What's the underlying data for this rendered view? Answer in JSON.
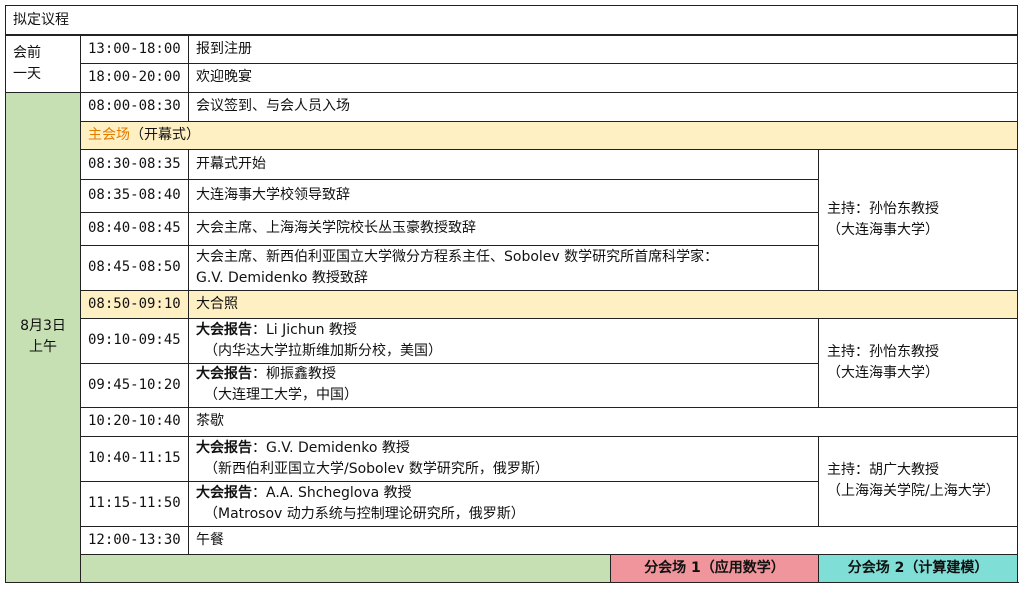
{
  "title": "拟定议程",
  "pre_day": {
    "label_line1": "会前",
    "label_line2": "一天",
    "rows": [
      {
        "time": "13:00-18:00",
        "event": "报到注册"
      },
      {
        "time": "18:00-20:00",
        "event": "欢迎晚宴"
      }
    ]
  },
  "day1": {
    "label_line1": "8月3日",
    "label_line2": "上午",
    "checkin": {
      "time": "08:00-08:30",
      "event": "会议签到、与会人员入场"
    },
    "venue": {
      "name": "主会场",
      "note": "（开幕式）"
    },
    "opening": [
      {
        "time": "08:30-08:35",
        "event": "开幕式开始"
      },
      {
        "time": "08:35-08:40",
        "event": "大连海事大学校领导致辞"
      },
      {
        "time": "08:40-08:45",
        "event": "大会主席、上海海关学院校长丛玉豪教授致辞"
      },
      {
        "time": "08:45-08:50",
        "event": "大会主席、新西伯利亚国立大学微分方程系主任、Sobolev 数学研究所首席科学家：",
        "event2": "G.V. Demidenko 教授致辞"
      }
    ],
    "host1": {
      "line1": "主持：孙怡东教授",
      "line2": "（大连海事大学）"
    },
    "photo": {
      "time": "08:50-09:10",
      "event": "大合照"
    },
    "talks1": [
      {
        "time": "09:10-09:45",
        "prefix": "大会报告",
        "speaker": "：Li Jichun 教授",
        "affil": "（内华达大学拉斯维加斯分校，美国）"
      },
      {
        "time": "09:45-10:20",
        "prefix": "大会报告",
        "speaker": "：柳振鑫教授",
        "affil": "（大连理工大学，中国）"
      }
    ],
    "host2": {
      "line1": "主持：孙怡东教授",
      "line2": "（大连海事大学）"
    },
    "tea": {
      "time": "10:20-10:40",
      "event": "茶歇"
    },
    "talks2": [
      {
        "time": "10:40-11:15",
        "prefix": "大会报告",
        "speaker": "：G.V. Demidenko 教授",
        "affil": "（新西伯利亚国立大学/Sobolev 数学研究所，俄罗斯）"
      },
      {
        "time": "11:15-11:50",
        "prefix": "大会报告",
        "speaker": "：A.A. Shcheglova 教授",
        "affil": "（Matrosov 动力系统与控制理论研究所，俄罗斯）"
      }
    ],
    "host3": {
      "line1": "主持：胡广大教授",
      "line2": "（上海海关学院/上海大学）"
    },
    "lunch": {
      "time": "12:00-13:30",
      "event": "午餐"
    }
  },
  "branches": {
    "branch1": "分会场 1（应用数学）",
    "branch2": "分会场 2（计算建模）"
  },
  "colors": {
    "day_green": "#c6e0b4",
    "highlight_yellow": "#fff0c4",
    "venue_orange": "#e07c00",
    "branch1_pink": "#f0959b",
    "branch2_teal": "#7fdfd6"
  }
}
